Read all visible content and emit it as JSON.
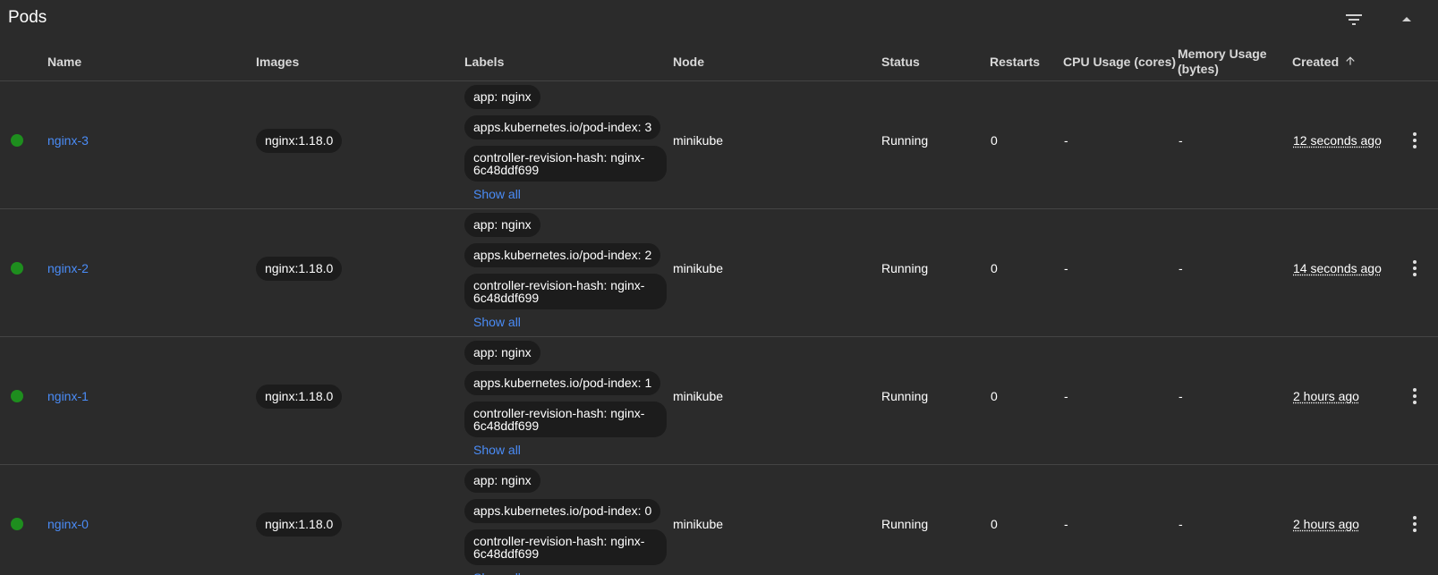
{
  "header": {
    "title": "Pods",
    "filter_icon": "filter-list-icon",
    "collapse_icon": "arrow-drop-up-icon"
  },
  "columns": {
    "name": "Name",
    "images": "Images",
    "labels": "Labels",
    "node": "Node",
    "status": "Status",
    "restarts": "Restarts",
    "cpu": "CPU Usage (cores)",
    "memory_line1": "Memory Usage",
    "memory_line2": "(bytes)",
    "created": "Created",
    "sort_icon": "arrow-upward-icon"
  },
  "colors": {
    "status_running": "#1e8e1e",
    "link": "#4a8cf7",
    "background": "#2b2b2b",
    "chip_background": "#1c1c1c"
  },
  "rows": [
    {
      "name": "nginx-3",
      "image": "nginx:1.18.0",
      "labels": [
        "app: nginx",
        "apps.kubernetes.io/pod-index: 3",
        "controller-revision-hash: nginx-6c48ddf699"
      ],
      "show_all": "Show all",
      "node": "minikube",
      "status": "Running",
      "restarts": "0",
      "cpu": "-",
      "memory": "-",
      "created": "12 seconds ago",
      "menu_icon": "more-vert-icon"
    },
    {
      "name": "nginx-2",
      "image": "nginx:1.18.0",
      "labels": [
        "app: nginx",
        "apps.kubernetes.io/pod-index: 2",
        "controller-revision-hash: nginx-6c48ddf699"
      ],
      "show_all": "Show all",
      "node": "minikube",
      "status": "Running",
      "restarts": "0",
      "cpu": "-",
      "memory": "-",
      "created": "14 seconds ago",
      "menu_icon": "more-vert-icon"
    },
    {
      "name": "nginx-1",
      "image": "nginx:1.18.0",
      "labels": [
        "app: nginx",
        "apps.kubernetes.io/pod-index: 1",
        "controller-revision-hash: nginx-6c48ddf699"
      ],
      "show_all": "Show all",
      "node": "minikube",
      "status": "Running",
      "restarts": "0",
      "cpu": "-",
      "memory": "-",
      "created": "2 hours ago",
      "menu_icon": "more-vert-icon"
    },
    {
      "name": "nginx-0",
      "image": "nginx:1.18.0",
      "labels": [
        "app: nginx",
        "apps.kubernetes.io/pod-index: 0",
        "controller-revision-hash: nginx-6c48ddf699"
      ],
      "show_all": "Show all",
      "node": "minikube",
      "status": "Running",
      "restarts": "0",
      "cpu": "-",
      "memory": "-",
      "created": "2 hours ago",
      "menu_icon": "more-vert-icon"
    }
  ]
}
